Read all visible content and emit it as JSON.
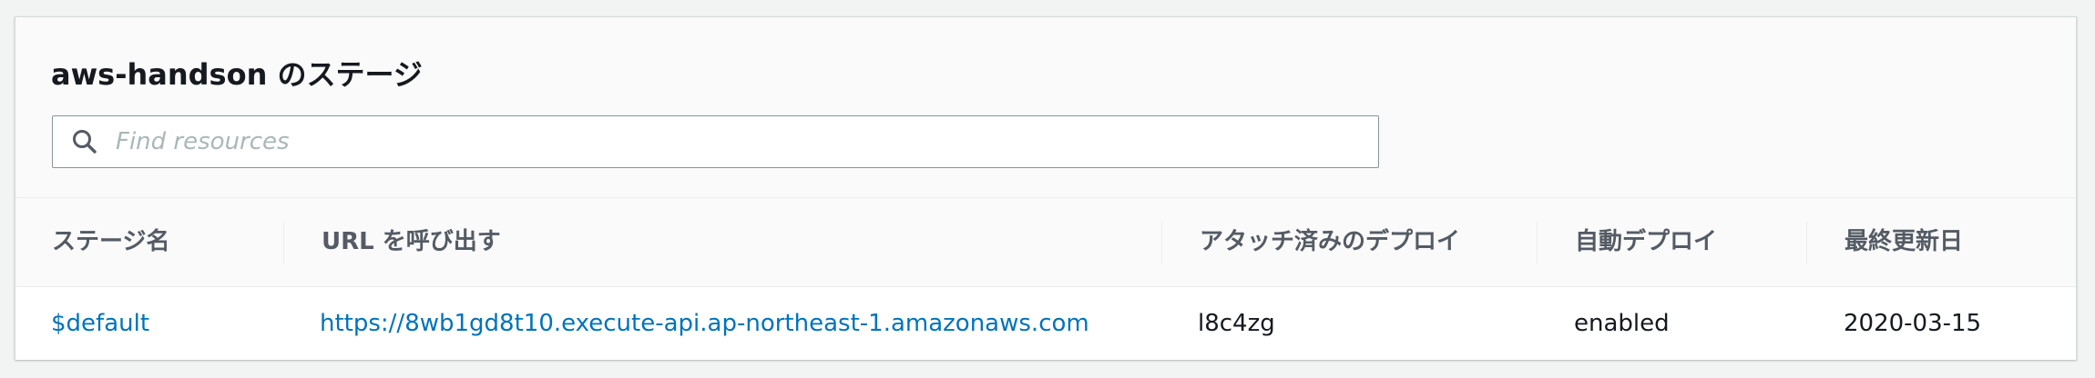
{
  "panel": {
    "title": "aws-handson のステージ"
  },
  "search": {
    "placeholder": "Find resources",
    "value": ""
  },
  "table": {
    "columns": [
      "ステージ名",
      "URL を呼び出す",
      "アタッチ済みのデプロイ",
      "自動デプロイ",
      "最終更新日"
    ],
    "rows": [
      {
        "stage_name": "$default",
        "invoke_url": "https://8wb1gd8t10.execute-api.ap-northeast-1.amazonaws.com",
        "attached_deployment": "l8c4zg",
        "auto_deploy": "enabled",
        "last_updated": "2020-03-15"
      }
    ]
  },
  "colors": {
    "background": "#f2f3f3",
    "link": "#0073bb",
    "text": "#16191f",
    "header_text": "#545b64",
    "border": "#879596"
  },
  "icons": {
    "search": "search-icon"
  }
}
